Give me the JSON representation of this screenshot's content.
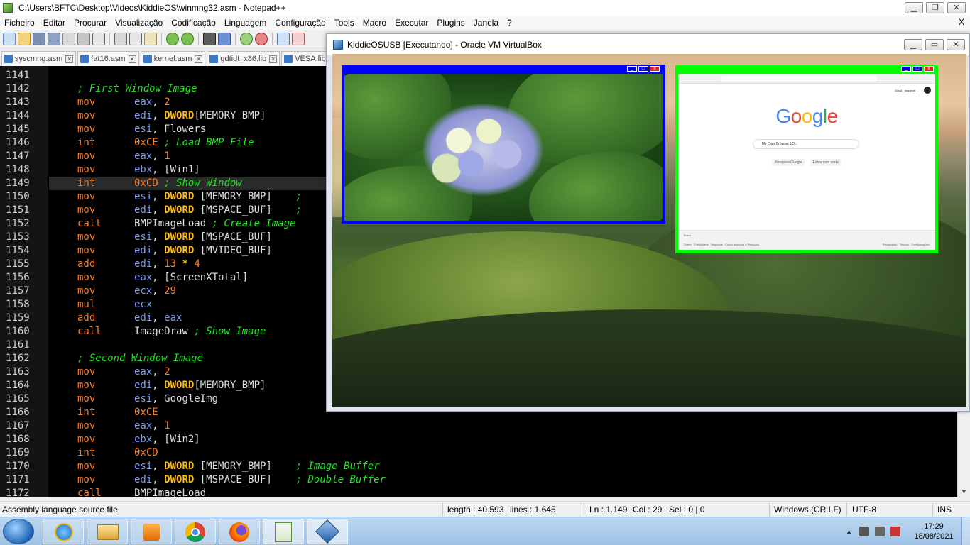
{
  "notepad": {
    "title": "C:\\Users\\BFTC\\Desktop\\Videos\\KiddieOS\\winmng32.asm - Notepad++",
    "menu": [
      "Ficheiro",
      "Editar",
      "Procurar",
      "Visualização",
      "Codificação",
      "Linguagem",
      "Configuração",
      "Tools",
      "Macro",
      "Executar",
      "Plugins",
      "Janela",
      "?"
    ],
    "menu_close": "X",
    "tabs": [
      "syscmng.asm",
      "fat16.asm",
      "kernel.asm",
      "gdtidt_x86.lib",
      "VESA.lib"
    ],
    "lines": [
      {
        "n": "1141",
        "kind": "blank"
      },
      {
        "n": "1142",
        "kind": "comment",
        "text": "; First Window Image"
      },
      {
        "n": "1143",
        "kind": "ins",
        "ins": "mov",
        "ops": [
          [
            "reg",
            "eax"
          ],
          [
            "idn",
            ", "
          ],
          [
            "num",
            "2"
          ]
        ]
      },
      {
        "n": "1144",
        "kind": "ins",
        "ins": "mov",
        "ops": [
          [
            "reg",
            "edi"
          ],
          [
            "idn",
            ", "
          ],
          [
            "kw",
            "DWORD"
          ],
          [
            "idn",
            "[MEMORY_BMP]"
          ]
        ]
      },
      {
        "n": "1145",
        "kind": "ins",
        "ins": "mov",
        "ops": [
          [
            "reg",
            "esi"
          ],
          [
            "idn",
            ", Flowers"
          ]
        ]
      },
      {
        "n": "1146",
        "kind": "ins",
        "ins": "int",
        "ops": [
          [
            "num",
            "0xCE"
          ],
          [
            "idn",
            " "
          ],
          [
            "cmt",
            "; Load BMP File"
          ]
        ]
      },
      {
        "n": "1147",
        "kind": "ins",
        "ins": "mov",
        "ops": [
          [
            "reg",
            "eax"
          ],
          [
            "idn",
            ", "
          ],
          [
            "num",
            "1"
          ]
        ]
      },
      {
        "n": "1148",
        "kind": "ins",
        "ins": "mov",
        "ops": [
          [
            "reg",
            "ebx"
          ],
          [
            "idn",
            ", [Win1]"
          ]
        ]
      },
      {
        "n": "1149",
        "kind": "ins",
        "ins": "int",
        "current": true,
        "ops": [
          [
            "num",
            "0xCD"
          ],
          [
            "idn",
            " "
          ],
          [
            "cmt",
            "; Show Window"
          ]
        ]
      },
      {
        "n": "1150",
        "kind": "ins",
        "ins": "mov",
        "ops": [
          [
            "reg",
            "esi"
          ],
          [
            "idn",
            ", "
          ],
          [
            "kw",
            "DWORD"
          ],
          [
            "idn",
            " [MEMORY_BMP]    "
          ],
          [
            "cmt",
            ";"
          ]
        ]
      },
      {
        "n": "1151",
        "kind": "ins",
        "ins": "mov",
        "ops": [
          [
            "reg",
            "edi"
          ],
          [
            "idn",
            ", "
          ],
          [
            "kw",
            "DWORD"
          ],
          [
            "idn",
            " [MSPACE_BUF]    "
          ],
          [
            "cmt",
            ";"
          ]
        ]
      },
      {
        "n": "1152",
        "kind": "ins",
        "ins": "call",
        "ops": [
          [
            "idn",
            "BMPImageLoad "
          ],
          [
            "cmt",
            "; Create Image"
          ]
        ]
      },
      {
        "n": "1153",
        "kind": "ins",
        "ins": "mov",
        "ops": [
          [
            "reg",
            "esi"
          ],
          [
            "idn",
            ", "
          ],
          [
            "kw",
            "DWORD"
          ],
          [
            "idn",
            " [MSPACE_BUF]"
          ]
        ]
      },
      {
        "n": "1154",
        "kind": "ins",
        "ins": "mov",
        "ops": [
          [
            "reg",
            "edi"
          ],
          [
            "idn",
            ", "
          ],
          [
            "kw",
            "DWORD"
          ],
          [
            "idn",
            " [MVIDEO_BUF]"
          ]
        ]
      },
      {
        "n": "1155",
        "kind": "ins",
        "ins": "add",
        "ops": [
          [
            "reg",
            "edi"
          ],
          [
            "idn",
            ", "
          ],
          [
            "num",
            "13"
          ],
          [
            "kw",
            " * "
          ],
          [
            "num",
            "4"
          ]
        ]
      },
      {
        "n": "1156",
        "kind": "ins",
        "ins": "mov",
        "ops": [
          [
            "reg",
            "eax"
          ],
          [
            "idn",
            ", [ScreenXTotal]"
          ]
        ]
      },
      {
        "n": "1157",
        "kind": "ins",
        "ins": "mov",
        "ops": [
          [
            "reg",
            "ecx"
          ],
          [
            "idn",
            ", "
          ],
          [
            "num",
            "29"
          ]
        ]
      },
      {
        "n": "1158",
        "kind": "ins",
        "ins": "mul",
        "ops": [
          [
            "reg",
            "ecx"
          ]
        ]
      },
      {
        "n": "1159",
        "kind": "ins",
        "ins": "add",
        "ops": [
          [
            "reg",
            "edi"
          ],
          [
            "idn",
            ", "
          ],
          [
            "reg",
            "eax"
          ]
        ]
      },
      {
        "n": "1160",
        "kind": "ins",
        "ins": "call",
        "ops": [
          [
            "idn",
            "ImageDraw "
          ],
          [
            "cmt",
            "; Show Image"
          ]
        ]
      },
      {
        "n": "1161",
        "kind": "blank"
      },
      {
        "n": "1162",
        "kind": "comment",
        "text": "; Second Window Image"
      },
      {
        "n": "1163",
        "kind": "ins",
        "ins": "mov",
        "ops": [
          [
            "reg",
            "eax"
          ],
          [
            "idn",
            ", "
          ],
          [
            "num",
            "2"
          ]
        ]
      },
      {
        "n": "1164",
        "kind": "ins",
        "ins": "mov",
        "ops": [
          [
            "reg",
            "edi"
          ],
          [
            "idn",
            ", "
          ],
          [
            "kw",
            "DWORD"
          ],
          [
            "idn",
            "[MEMORY_BMP]"
          ]
        ]
      },
      {
        "n": "1165",
        "kind": "ins",
        "ins": "mov",
        "ops": [
          [
            "reg",
            "esi"
          ],
          [
            "idn",
            ", GoogleImg"
          ]
        ]
      },
      {
        "n": "1166",
        "kind": "ins",
        "ins": "int",
        "ops": [
          [
            "num",
            "0xCE"
          ]
        ]
      },
      {
        "n": "1167",
        "kind": "ins",
        "ins": "mov",
        "ops": [
          [
            "reg",
            "eax"
          ],
          [
            "idn",
            ", "
          ],
          [
            "num",
            "1"
          ]
        ]
      },
      {
        "n": "1168",
        "kind": "ins",
        "ins": "mov",
        "ops": [
          [
            "reg",
            "ebx"
          ],
          [
            "idn",
            ", [Win2]"
          ]
        ]
      },
      {
        "n": "1169",
        "kind": "ins",
        "ins": "int",
        "ops": [
          [
            "num",
            "0xCD"
          ]
        ]
      },
      {
        "n": "1170",
        "kind": "ins",
        "ins": "mov",
        "ops": [
          [
            "reg",
            "esi"
          ],
          [
            "idn",
            ", "
          ],
          [
            "kw",
            "DWORD"
          ],
          [
            "idn",
            " [MEMORY_BMP]    "
          ],
          [
            "cmt",
            "; Image Buffer"
          ]
        ]
      },
      {
        "n": "1171",
        "kind": "ins",
        "ins": "mov",
        "ops": [
          [
            "reg",
            "edi"
          ],
          [
            "idn",
            ", "
          ],
          [
            "kw",
            "DWORD"
          ],
          [
            "idn",
            " [MSPACE_BUF]    "
          ],
          [
            "cmt",
            "; Double_Buffer"
          ]
        ]
      },
      {
        "n": "1172",
        "kind": "ins",
        "ins": "call",
        "ops": [
          [
            "idn",
            "BMPImageLoad"
          ]
        ]
      }
    ],
    "status": {
      "filetype": "Assembly language source file",
      "length": "length : 40.593",
      "lines": "lines : 1.645",
      "ln": "Ln : 1.149",
      "col": "Col : 29",
      "sel": "Sel : 0 | 0",
      "eol": "Windows (CR LF)",
      "encoding": "UTF-8",
      "mode": "INS"
    }
  },
  "vbox": {
    "title": "KiddieOSUSB [Executando] - Oracle VM VirtualBox",
    "google": {
      "logo": [
        "G",
        "o",
        "o",
        "g",
        "l",
        "e"
      ],
      "logo_colors": [
        "#4285f4",
        "#ea4335",
        "#fbbc05",
        "#4285f4",
        "#34a853",
        "#ea4335"
      ],
      "search_text": "My Own Browser LOL",
      "buttons": [
        "Pesquisa Google",
        "Estou com sorte"
      ],
      "top_links": [
        "Gmail",
        "Imagens"
      ],
      "footer_country": "Brasil",
      "footer_left": [
        "Sobre",
        "Publicidade",
        "Negócios",
        "Como funciona a Pesquisa"
      ],
      "footer_right": [
        "Privacidade",
        "Termos",
        "Configurações"
      ]
    }
  },
  "taskbar": {
    "apps": [
      "ie-icon",
      "explorer-icon",
      "media-player-icon",
      "chrome-icon",
      "firefox-icon",
      "notepadpp-icon",
      "virtualbox-icon"
    ],
    "time": "17:29",
    "date": "18/08/2021"
  },
  "colors": {
    "editor_bg": "#000000",
    "instruction": "#ff7c1e",
    "register": "#7b9cf0",
    "keyword": "#ffbf0a",
    "comment": "#1ee51e",
    "os_window1": "#0000ff",
    "os_window2": "#00ff00"
  }
}
